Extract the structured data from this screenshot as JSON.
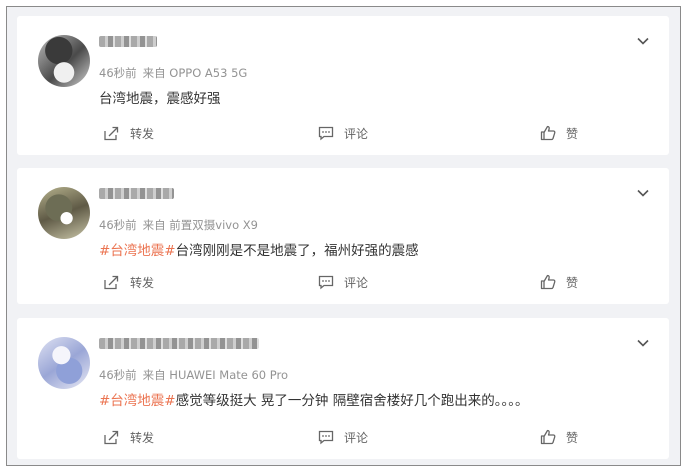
{
  "posts": [
    {
      "time": "46秒前",
      "source": "来自 OPPO A53 5G",
      "tag": "",
      "text": "台湾地震，震感好强",
      "actions": {
        "repost": "转发",
        "comment": "评论",
        "like": "赞"
      }
    },
    {
      "time": "46秒前",
      "source": "来自 前置双摄vivo X9",
      "tag": "#台湾地震#",
      "text": "台湾刚刚是不是地震了，福州好强的震感",
      "actions": {
        "repost": "转发",
        "comment": "评论",
        "like": "赞"
      }
    },
    {
      "time": "46秒前",
      "source": "来自 HUAWEI Mate 60 Pro",
      "tag": "#台湾地震#",
      "text": "感觉等级挺大 晃了一分钟 隔壁宿舍楼好几个跑出来的。。。。",
      "actions": {
        "repost": "转发",
        "comment": "评论",
        "like": "赞"
      }
    }
  ],
  "colors": {
    "tag": "#eb7350",
    "background": "#f1f2f5",
    "text": "#333333",
    "meta": "#939393"
  },
  "icons": [
    "chevron-down-icon",
    "repost-icon",
    "comment-icon",
    "like-icon"
  ]
}
